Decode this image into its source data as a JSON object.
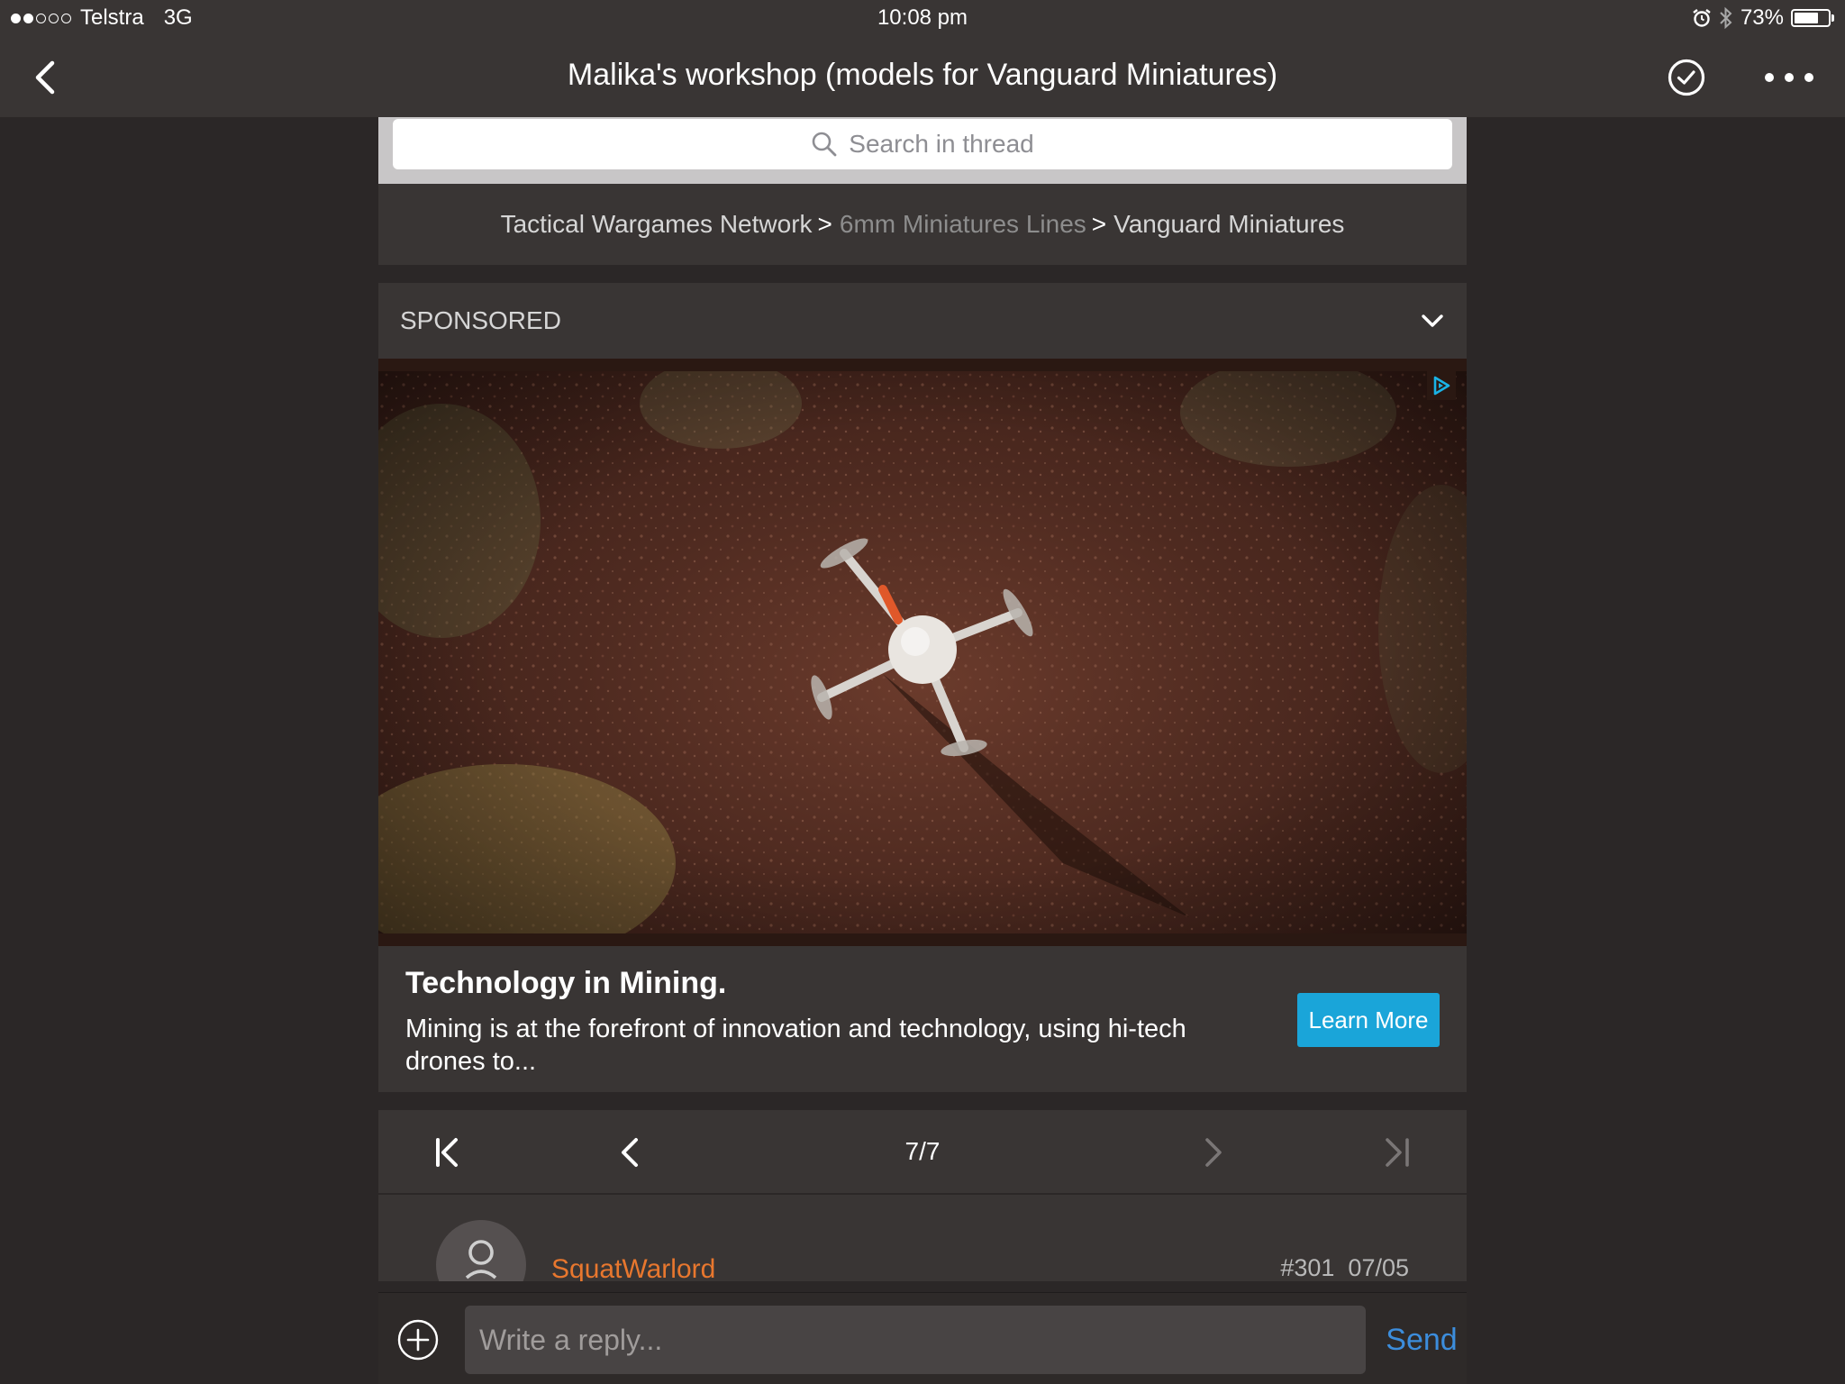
{
  "status_bar": {
    "carrier": "Telstra",
    "network": "3G",
    "time": "10:08 pm",
    "battery_percent": "73%",
    "battery_level": 0.73,
    "signal_bars_filled": 2,
    "signal_bars_total": 5,
    "icons": [
      "alarm-icon",
      "bluetooth-icon",
      "battery-icon"
    ]
  },
  "nav": {
    "title": "Malika's workshop (models for Vanguard Miniatures)",
    "icons": [
      "chevron-left-icon",
      "check-circle-icon",
      "more-icon"
    ]
  },
  "search": {
    "placeholder": "Search in thread",
    "icon": "search-icon"
  },
  "breadcrumb": {
    "items": [
      "Tactical Wargames Network",
      "6mm Miniatures Lines",
      "Vanguard Miniatures"
    ],
    "separator": ">"
  },
  "sponsored": {
    "label": "SPONSORED",
    "icon": "chevron-down-icon",
    "ad": {
      "title": "Technology in Mining.",
      "description": "Mining is at the forefront of innovation and technology, using hi-tech drones to...",
      "cta_label": "Learn More",
      "cta_color": "#1aa5d9",
      "adchoices_icon": "adchoices-icon"
    }
  },
  "pager": {
    "current": "7/7",
    "icons": [
      "first-page-icon",
      "prev-page-icon",
      "next-page-icon",
      "last-page-icon"
    ]
  },
  "post": {
    "username": "SquatWarlord",
    "post_number": "#301",
    "date": "07/05",
    "username_color": "#e8772e"
  },
  "reply": {
    "placeholder": "Write a reply...",
    "send_label": "Send",
    "send_color": "#3c8ddc",
    "add_icon": "plus-circle-icon"
  }
}
